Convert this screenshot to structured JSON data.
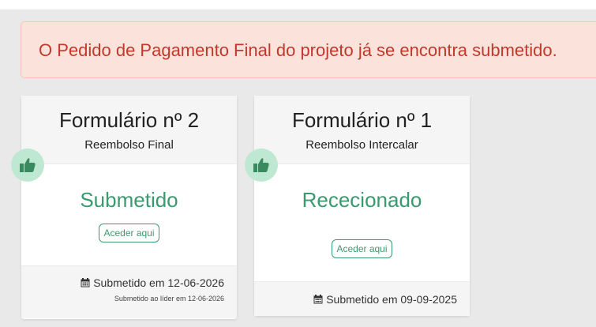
{
  "alert": {
    "text": "O Pedido de Pagamento Final do projeto já se encontra submetido."
  },
  "cards": [
    {
      "title": "Formulário nº 2",
      "subtitle": "Reembolso Final",
      "status": "Submetido",
      "button": "Aceder aqui",
      "footer_main": "Submetido em 12-06-2026",
      "footer_sub": "Submetido ao líder em 12-06-2026"
    },
    {
      "title": "Formulário nº 1",
      "subtitle": "Reembolso Intercalar",
      "status": "Rececionado",
      "button": "Aceder aqui",
      "footer_main": "Submetido em 09-09-2025"
    }
  ],
  "icons": {
    "thumb": "thumbs-up-icon",
    "calendar": "calendar-icon"
  },
  "colors": {
    "alert_text": "#c0392b",
    "alert_bg": "#fbe3dc",
    "status": "#3a9a6f",
    "thumb_bg": "#bfe8d3"
  }
}
